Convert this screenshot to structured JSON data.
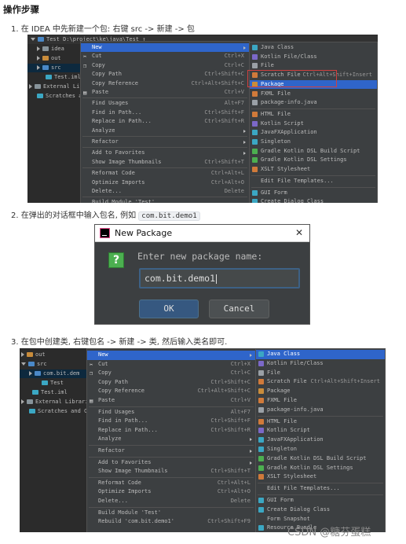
{
  "heading": "操作步骤",
  "steps": [
    {
      "num": "1.",
      "text": "在 IDEA 中先新建一个包: 右键 src -> 新建 -> 包"
    },
    {
      "num": "2.",
      "text_before": "在弹出的对话框中输入包名, 例如 ",
      "code": "com.bit.demo1"
    },
    {
      "num": "3.",
      "text": "在包中创建类, 右键包名 -> 新建 -> 类, 然后输入类名即可."
    }
  ],
  "shot1": {
    "project_path": "Test  D:\\project\\ke\\java\\Test ↑",
    "tree": [
      "Test",
      "idea",
      "out",
      "src",
      "Test.iml",
      "External Li",
      "Scratches a"
    ],
    "menu": [
      {
        "icon": "",
        "label": "New",
        "key": "",
        "sub": true,
        "hl": true
      },
      {
        "icon": "✂",
        "label": "Cut",
        "key": "Ctrl+X"
      },
      {
        "icon": "❐",
        "label": "Copy",
        "key": "Ctrl+C"
      },
      {
        "icon": "",
        "label": "Copy Path",
        "key": "Ctrl+Shift+C"
      },
      {
        "icon": "",
        "label": "Copy Reference",
        "key": "Ctrl+Alt+Shift+C"
      },
      {
        "icon": "▤",
        "label": "Paste",
        "key": "Ctrl+V"
      },
      {
        "sep": true
      },
      {
        "icon": "",
        "label": "Find Usages",
        "key": "Alt+F7"
      },
      {
        "icon": "",
        "label": "Find in Path...",
        "key": "Ctrl+Shift+F"
      },
      {
        "icon": "",
        "label": "Replace in Path...",
        "key": "Ctrl+Shift+R"
      },
      {
        "icon": "",
        "label": "Analyze",
        "key": "",
        "sub": true
      },
      {
        "sep": true
      },
      {
        "icon": "",
        "label": "Refactor",
        "key": "",
        "sub": true
      },
      {
        "sep": true
      },
      {
        "icon": "",
        "label": "Add to Favorites",
        "key": "",
        "sub": true
      },
      {
        "icon": "",
        "label": "Show Image Thumbnails",
        "key": "Ctrl+Shift+T"
      },
      {
        "sep": true
      },
      {
        "icon": "",
        "label": "Reformat Code",
        "key": "Ctrl+Alt+L"
      },
      {
        "icon": "",
        "label": "Optimize Imports",
        "key": "Ctrl+Alt+O"
      },
      {
        "icon": "",
        "label": "Delete...",
        "key": "Delete"
      },
      {
        "sep": true
      },
      {
        "icon": "",
        "label": "Build Module 'Test'",
        "key": ""
      }
    ],
    "sub": [
      {
        "c": "#3ba7c3",
        "label": "Java Class",
        "key": ""
      },
      {
        "c": "#7b68c8",
        "label": "Kotlin File/Class",
        "key": ""
      },
      {
        "c": "#9aa0a6",
        "label": "File",
        "key": ""
      },
      {
        "c": "#d07a3a",
        "label": "Scratch File",
        "key": "Ctrl+Alt+Shift+Insert"
      },
      {
        "c": "#c98c3b",
        "label": "Package",
        "key": "",
        "hl": true
      },
      {
        "c": "#d07a3a",
        "label": "FXML File",
        "key": ""
      },
      {
        "c": "#9aa0a6",
        "label": "package-info.java",
        "key": ""
      },
      {
        "sep": true
      },
      {
        "c": "#d07a3a",
        "label": "HTML File",
        "key": ""
      },
      {
        "c": "#7b68c8",
        "label": "Kotlin Script",
        "key": ""
      },
      {
        "c": "#3ba7c3",
        "label": "JavaFXApplication",
        "key": ""
      },
      {
        "c": "#3ba7c3",
        "label": "Singleton",
        "key": ""
      },
      {
        "c": "#4caf50",
        "label": "Gradle Kotlin DSL Build Script",
        "key": ""
      },
      {
        "c": "#4caf50",
        "label": "Gradle Kotlin DSL Settings",
        "key": ""
      },
      {
        "c": "#d07a3a",
        "label": "XSLT Stylesheet",
        "key": ""
      },
      {
        "sep": true
      },
      {
        "c": "",
        "label": "Edit File Templates...",
        "key": ""
      },
      {
        "sep": true
      },
      {
        "c": "#3ba7c3",
        "label": "GUI Form",
        "key": ""
      },
      {
        "c": "#3ba7c3",
        "label": "Create Dialog Class",
        "key": ""
      }
    ]
  },
  "dialog": {
    "title": "New Package",
    "close": "✕",
    "prompt": "Enter new package name:",
    "value": "com.bit.demo1",
    "ok": "OK",
    "cancel": "Cancel"
  },
  "shot3": {
    "tree": [
      "out",
      "src",
      "com.bit.dem",
      "Test",
      "Test.iml",
      "External Librarie",
      "Scratches and Con"
    ],
    "menu": [
      {
        "icon": "",
        "label": "New",
        "key": "",
        "sub": true,
        "hl": true
      },
      {
        "icon": "✂",
        "label": "Cut",
        "key": "Ctrl+X"
      },
      {
        "icon": "❐",
        "label": "Copy",
        "key": "Ctrl+C"
      },
      {
        "icon": "",
        "label": "Copy Path",
        "key": "Ctrl+Shift+C"
      },
      {
        "icon": "",
        "label": "Copy Reference",
        "key": "Ctrl+Alt+Shift+C"
      },
      {
        "icon": "▤",
        "label": "Paste",
        "key": "Ctrl+V"
      },
      {
        "sep": true
      },
      {
        "icon": "",
        "label": "Find Usages",
        "key": "Alt+F7"
      },
      {
        "icon": "",
        "label": "Find in Path...",
        "key": "Ctrl+Shift+F"
      },
      {
        "icon": "",
        "label": "Replace in Path...",
        "key": "Ctrl+Shift+R"
      },
      {
        "icon": "",
        "label": "Analyze",
        "key": "",
        "sub": true
      },
      {
        "sep": true
      },
      {
        "icon": "",
        "label": "Refactor",
        "key": "",
        "sub": true
      },
      {
        "sep": true
      },
      {
        "icon": "",
        "label": "Add to Favorites",
        "key": "",
        "sub": true
      },
      {
        "icon": "",
        "label": "Show Image Thumbnails",
        "key": "Ctrl+Shift+T"
      },
      {
        "sep": true
      },
      {
        "icon": "",
        "label": "Reformat Code",
        "key": "Ctrl+Alt+L"
      },
      {
        "icon": "",
        "label": "Optimize Imports",
        "key": "Ctrl+Alt+O"
      },
      {
        "icon": "",
        "label": "Delete...",
        "key": "Delete"
      },
      {
        "sep": true
      },
      {
        "icon": "",
        "label": "Build Module 'Test'",
        "key": ""
      },
      {
        "icon": "",
        "label": "Rebuild 'com.bit.demo1'",
        "key": "Ctrl+Shift+F9"
      }
    ],
    "sub": [
      {
        "c": "#3ba7c3",
        "label": "Java Class",
        "key": "",
        "hl": true
      },
      {
        "c": "#7b68c8",
        "label": "Kotlin File/Class",
        "key": ""
      },
      {
        "c": "#9aa0a6",
        "label": "File",
        "key": ""
      },
      {
        "c": "#d07a3a",
        "label": "Scratch File",
        "key": "Ctrl+Alt+Shift+Insert"
      },
      {
        "c": "#c98c3b",
        "label": "Package",
        "key": ""
      },
      {
        "c": "#d07a3a",
        "label": "FXML File",
        "key": ""
      },
      {
        "c": "#9aa0a6",
        "label": "package-info.java",
        "key": ""
      },
      {
        "sep": true
      },
      {
        "c": "#d07a3a",
        "label": "HTML File",
        "key": ""
      },
      {
        "c": "#7b68c8",
        "label": "Kotlin Script",
        "key": ""
      },
      {
        "c": "#3ba7c3",
        "label": "JavaFXApplication",
        "key": ""
      },
      {
        "c": "#3ba7c3",
        "label": "Singleton",
        "key": ""
      },
      {
        "c": "#4caf50",
        "label": "Gradle Kotlin DSL Build Script",
        "key": ""
      },
      {
        "c": "#4caf50",
        "label": "Gradle Kotlin DSL Settings",
        "key": ""
      },
      {
        "c": "#d07a3a",
        "label": "XSLT Stylesheet",
        "key": ""
      },
      {
        "sep": true
      },
      {
        "c": "",
        "label": "Edit File Templates...",
        "key": ""
      },
      {
        "sep": true
      },
      {
        "c": "#3ba7c3",
        "label": "GUI Form",
        "key": ""
      },
      {
        "c": "#3ba7c3",
        "label": "Create Dialog Class",
        "key": ""
      },
      {
        "c": "",
        "label": "Form Snapshot",
        "key": ""
      },
      {
        "c": "#3ba7c3",
        "label": "Resource Bundle",
        "key": ""
      }
    ]
  },
  "watermark": "CSDN @糖芬蛋糕"
}
